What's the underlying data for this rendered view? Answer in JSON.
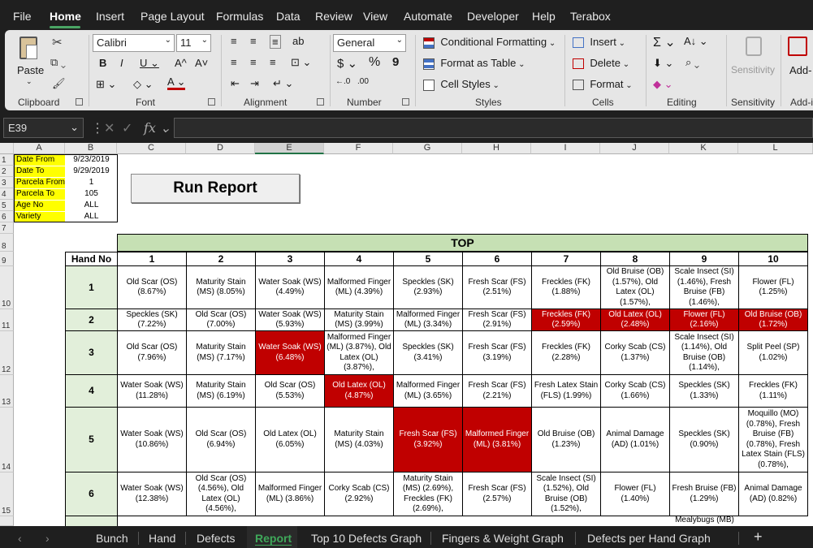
{
  "menu": {
    "tabs": [
      "File",
      "Home",
      "Insert",
      "Page Layout",
      "Formulas",
      "Data",
      "Review",
      "View",
      "Automate",
      "Developer",
      "Help",
      "Terabox"
    ]
  },
  "ribbon": {
    "groups": {
      "clipboard": "Clipboard",
      "font": "Font",
      "alignment": "Alignment",
      "number": "Number",
      "styles": "Styles",
      "cells": "Cells",
      "editing": "Editing",
      "sensitivity": "Sensitivity",
      "addins": "Add-i"
    },
    "paste": "Paste",
    "font_name": "Calibri",
    "font_size": "11",
    "number_format": "General",
    "cond_format": "Conditional Formatting",
    "format_table": "Format as Table",
    "cell_styles": "Cell Styles",
    "insert": "Insert",
    "delete": "Delete",
    "format": "Format",
    "sensitivity_btn": "Sensitivity",
    "addins_btn": "Add-"
  },
  "formula_bar": {
    "name_box": "E39",
    "formula": ""
  },
  "columns": [
    "A",
    "B",
    "C",
    "D",
    "E",
    "F",
    "G",
    "H",
    "I",
    "J",
    "K",
    "L"
  ],
  "rows": [
    "1",
    "2",
    "3",
    "4",
    "5",
    "6",
    "7",
    "8",
    "9",
    "10",
    "11",
    "12",
    "13",
    "14",
    "15"
  ],
  "params": [
    {
      "label": "Date From",
      "value": "9/23/2019"
    },
    {
      "label": "Date To",
      "value": "9/29/2019"
    },
    {
      "label": "Parcela From",
      "value": "1"
    },
    {
      "label": "Parcela To",
      "value": "105"
    },
    {
      "label": "Age No",
      "value": "ALL"
    },
    {
      "label": "Variety",
      "value": "ALL"
    }
  ],
  "run_button": "Run Report",
  "report": {
    "section_title": "TOP",
    "hand_no_header": "Hand No",
    "fingers": [
      "1",
      "2",
      "3",
      "4",
      "5",
      "6",
      "7",
      "8",
      "9",
      "10"
    ],
    "hands": [
      "1",
      "2",
      "3",
      "4",
      "5",
      "6"
    ],
    "cells": [
      [
        "Old Scar (OS) (8.67%)",
        "Maturity Stain (MS) (8.05%)",
        "Water Soak (WS) (4.49%)",
        "Malformed Finger (ML) (4.39%)",
        "Speckles (SK) (2.93%)",
        "Fresh Scar (FS) (2.51%)",
        "Freckles (FK) (1.88%)",
        "Old Bruise (OB) (1.57%), Old Latex (OL) (1.57%),",
        "Scale Insect (SI) (1.46%), Fresh Bruise (FB) (1.46%),",
        "Flower (FL) (1.25%)"
      ],
      [
        "Speckles (SK) (7.22%)",
        "Old Scar (OS) (7.00%)",
        "Water Soak (WS) (5.93%)",
        "Maturity Stain (MS) (3.99%)",
        "Malformed Finger (ML) (3.34%)",
        "Fresh Scar (FS) (2.91%)",
        "Freckles (FK) (2.59%)",
        "Old Latex (OL) (2.48%)",
        "Flower (FL) (2.16%)",
        "Old Bruise (OB) (1.72%)"
      ],
      [
        "Old Scar (OS) (7.96%)",
        "Maturity Stain (MS) (7.17%)",
        "Water Soak (WS) (6.48%)",
        "Malformed Finger (ML) (3.87%), Old Latex (OL) (3.87%),",
        "Speckles (SK) (3.41%)",
        "Fresh Scar (FS) (3.19%)",
        "Freckles (FK) (2.28%)",
        "Corky Scab (CS) (1.37%)",
        "Scale Insect (SI) (1.14%), Old Bruise (OB) (1.14%),",
        "Split Peel (SP) (1.02%)"
      ],
      [
        "Water Soak (WS) (11.28%)",
        "Maturity Stain (MS) (6.19%)",
        "Old Scar (OS) (5.53%)",
        "Old Latex (OL) (4.87%)",
        "Malformed Finger (ML) (3.65%)",
        "Fresh Scar (FS) (2.21%)",
        "Fresh Latex Stain (FLS) (1.99%)",
        "Corky Scab (CS) (1.66%)",
        "Speckles (SK) (1.33%)",
        "Freckles (FK) (1.11%)"
      ],
      [
        "Water Soak (WS) (10.86%)",
        "Old Scar (OS) (6.94%)",
        "Old Latex (OL) (6.05%)",
        "Maturity Stain (MS) (4.03%)",
        "Fresh Scar (FS) (3.92%)",
        "Malformed Finger (ML) (3.81%)",
        "Old Bruise (OB) (1.23%)",
        "Animal Damage (AD) (1.01%)",
        "Speckles (SK) (0.90%)",
        "Moquillo (MO) (0.78%), Fresh Bruise (FB) (0.78%), Fresh Latex Stain (FLS) (0.78%),"
      ],
      [
        "Water Soak (WS) (12.38%)",
        "Old Scar (OS) (4.56%), Old Latex (OL) (4.56%),",
        "Malformed Finger (ML) (3.86%)",
        "Corky Scab (CS) (2.92%)",
        "Maturity Stain (MS) (2.69%), Freckles (FK) (2.69%),",
        "Fresh Scar (FS) (2.57%)",
        "Scale Insect (SI) (1.52%), Old Bruise (OB) (1.52%),",
        "Flower (FL) (1.40%)",
        "Fresh Bruise (FB) (1.29%)",
        "Animal Damage (AD) (0.82%)"
      ]
    ],
    "partial_next": "Mealybugs (MB)"
  },
  "sheet_tabs": [
    "Bunch",
    "Hand",
    "Defects",
    "Report",
    "Top 10 Defects Graph",
    "Fingers & Weight Graph",
    "Defects per Hand Graph"
  ],
  "active_sheet": "Report"
}
